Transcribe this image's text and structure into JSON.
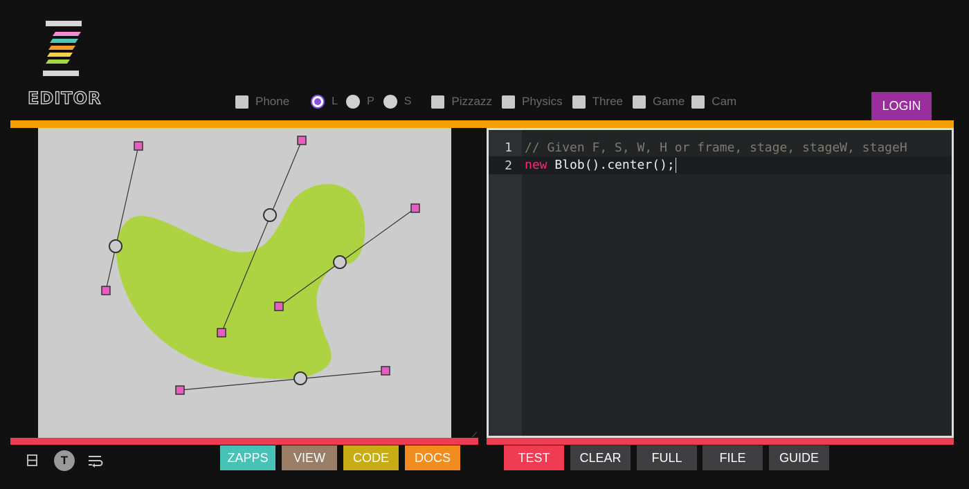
{
  "app": {
    "logo_text": "EDITOR"
  },
  "options": {
    "phone": "Phone",
    "l": "L",
    "p": "P",
    "s": "S",
    "pizzazz": "Pizzazz",
    "physics": "Physics",
    "three": "Three",
    "game": "Game",
    "cam": "Cam",
    "selected_orientation": "L"
  },
  "header": {
    "login_label": "LOGIN"
  },
  "editor": {
    "line_numbers": [
      "1",
      "2"
    ],
    "line1_comment": "// Given F, S, W, H or frame, stage, stageW, stageH",
    "line2_keyword": "new",
    "line2_code": " Blob().center();"
  },
  "toolbar_left": {
    "zapps": "ZAPPS",
    "view": "VIEW",
    "code": "CODE",
    "docs": "DOCS"
  },
  "toolbar_right": {
    "test": "TEST",
    "clear": "CLEAR",
    "full": "FULL",
    "file": "FILE",
    "guide": "GUIDE"
  },
  "bottom_icons": {
    "text_icon_letter": "T",
    "icons": [
      "split-view-icon",
      "text-toggle-icon",
      "word-wrap-icon"
    ]
  },
  "colors": {
    "logo_stripes": [
      "#f08dd3",
      "#4fc7b5",
      "#f59b34",
      "#f3d24a",
      "#a8d44b"
    ],
    "accent_orange": "#f59f00",
    "accent_red": "#f03c53",
    "login_purple": "#9b2e9e",
    "blob_green": "#add343",
    "control_pink": "#e560be",
    "zapps": "#47c2b6",
    "view": "#9a7d66",
    "code": "#c8ac15",
    "docs": "#f08d1e",
    "test": "#f03c53",
    "dark_button": "#3f3f41"
  }
}
